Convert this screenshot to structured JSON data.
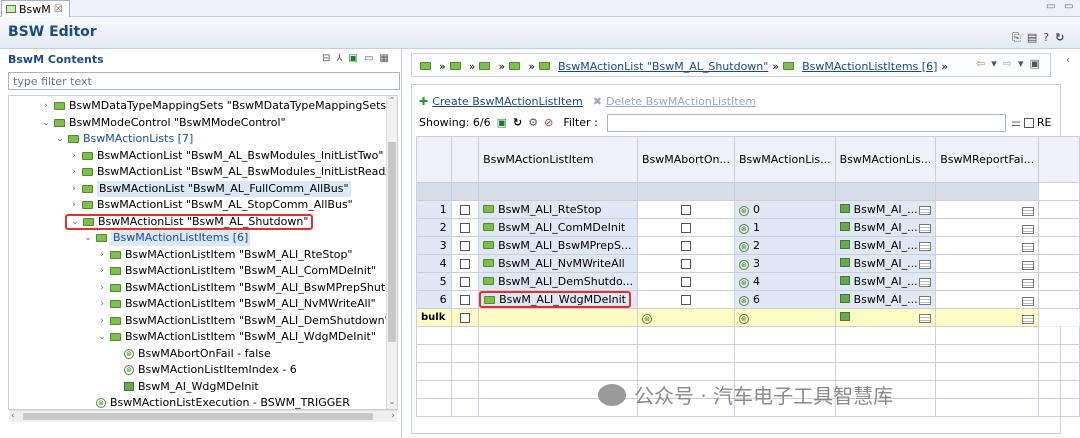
{
  "tab": {
    "title": "BswM",
    "close": "☒"
  },
  "editor": {
    "title": "BSW Editor"
  },
  "left": {
    "section_title": "BswM Contents",
    "filter_placeholder": "type filter text",
    "tree": [
      {
        "label": "BswMDataTypeMappingSets \"BswMDataTypeMappingSets\"",
        "indent": 1,
        "twist": "›",
        "icon": "folder"
      },
      {
        "label": "BswMModeControl \"BswMModeControl\"",
        "indent": 1,
        "twist": "⌄",
        "icon": "folder"
      },
      {
        "label": "BswMActionLists [7]",
        "indent": 2,
        "twist": "⌄",
        "icon": "folder",
        "link": true
      },
      {
        "label": "BswMActionList \"BswM_AL_BswModules_InitListTwo\"",
        "indent": 3,
        "twist": "›",
        "icon": "folder"
      },
      {
        "label": "BswMActionList \"BswM_AL_BswModules_InitListReadAll\"",
        "indent": 3,
        "twist": "›",
        "icon": "folder"
      },
      {
        "label": "BswMActionList \"BswM_AL_FullComm_AllBus\"",
        "indent": 3,
        "twist": "›",
        "icon": "folder",
        "sel": true
      },
      {
        "label": "BswMActionList \"BswM_AL_StopComm_AllBus\"",
        "indent": 3,
        "twist": "›",
        "icon": "folder"
      },
      {
        "label": "BswMActionList \"BswM_AL_Shutdown\"",
        "indent": 3,
        "twist": "⌄",
        "icon": "folder",
        "red": true
      },
      {
        "label": "BswMActionListItems [6]",
        "indent": 4,
        "twist": "⌄",
        "icon": "folder",
        "link": true,
        "sel": true
      },
      {
        "label": "BswMActionListItem \"BswM_ALI_RteStop\"",
        "indent": 5,
        "twist": "›",
        "icon": "folder"
      },
      {
        "label": "BswMActionListItem \"BswM_ALI_ComMDeInit\"",
        "indent": 5,
        "twist": "›",
        "icon": "folder"
      },
      {
        "label": "BswMActionListItem \"BswM_ALI_BswMPrepShutdown\"",
        "indent": 5,
        "twist": "›",
        "icon": "folder"
      },
      {
        "label": "BswMActionListItem \"BswM_ALI_NvMWriteAll\"",
        "indent": 5,
        "twist": "›",
        "icon": "folder"
      },
      {
        "label": "BswMActionListItem \"BswM_ALI_DemShutdown\"",
        "indent": 5,
        "twist": "›",
        "icon": "folder"
      },
      {
        "label": "BswMActionListItem \"BswM_ALI_WdgMDeInit\"",
        "indent": 5,
        "twist": "⌄",
        "icon": "folder"
      },
      {
        "label": "BswMAbortOnFail - false",
        "indent": 6,
        "twist": "",
        "icon": "g"
      },
      {
        "label": "BswMActionListItemIndex - 6",
        "indent": 6,
        "twist": "",
        "icon": "g"
      },
      {
        "label": "BswM_AI_WdgMDeInit",
        "indent": 6,
        "twist": "",
        "icon": "r"
      },
      {
        "label": "BswMActionListExecution - BSWM_TRIGGER",
        "indent": 4,
        "twist": "",
        "icon": "g"
      }
    ]
  },
  "breadcrumb": {
    "item1": "BswMActionList \"BswM_AL_Shutdown\"",
    "item2": "BswMActionListItems [6]"
  },
  "toolbar": {
    "create": "Create BswMActionListItem",
    "delete": "Delete BswMActionListItem",
    "showing": "Showing: 6/6",
    "filter_label": "Filter :",
    "re": "RE"
  },
  "grid": {
    "headers": [
      "BswMActionListItem",
      "BswMAbortOn...",
      "BswMActionLis...",
      "BswMActionLis...",
      "BswMReportFai..."
    ],
    "rows": [
      {
        "num": "1",
        "name": "BswM_ALI_RteStop",
        "index": "0",
        "ref": "BswM_AI_..."
      },
      {
        "num": "2",
        "name": "BswM_ALI_ComMDeInit",
        "index": "1",
        "ref": "BswM_AI_..."
      },
      {
        "num": "3",
        "name": "BswM_ALI_BswMPrepS...",
        "index": "2",
        "ref": "BswM_AI_..."
      },
      {
        "num": "4",
        "name": "BswM_ALI_NvMWriteAll",
        "index": "3",
        "ref": "BswM_AI_..."
      },
      {
        "num": "5",
        "name": "BswM_ALI_DemShutdo...",
        "index": "4",
        "ref": "BswM_AI_..."
      },
      {
        "num": "6",
        "name": "BswM_ALI_WdgMDeInit",
        "index": "6",
        "ref": "BswM_AI_..."
      }
    ],
    "bulk": "bulk"
  },
  "watermark": "公众号 · 汽车电子工具智慧库"
}
